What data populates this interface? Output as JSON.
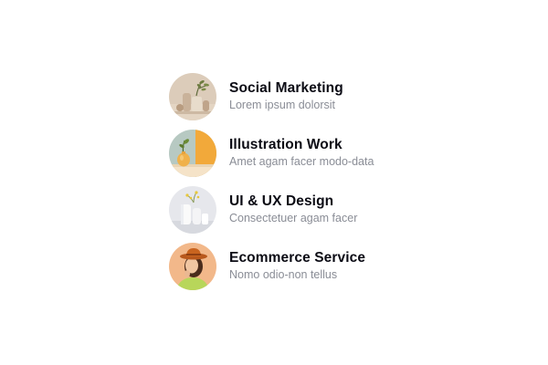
{
  "services": [
    {
      "title": "Social Marketing",
      "subtitle": "Lorem ipsum dolorsit",
      "thumbnail_icon": "vases-with-plant-photo",
      "bg_color": "#dcccba"
    },
    {
      "title": "Illustration Work",
      "subtitle": "Amet agam facer modo-data",
      "thumbnail_icon": "orange-vase-photo",
      "bg_color": "#f2a93a"
    },
    {
      "title": "UI & UX Design",
      "subtitle": "Consectetuer agam facer",
      "thumbnail_icon": "white-vases-photo",
      "bg_color": "#e6e7ec"
    },
    {
      "title": "Ecommerce Service",
      "subtitle": "Nomo odio-non tellus",
      "thumbnail_icon": "woman-with-hat-photo",
      "bg_color": "#f2b88a"
    }
  ]
}
